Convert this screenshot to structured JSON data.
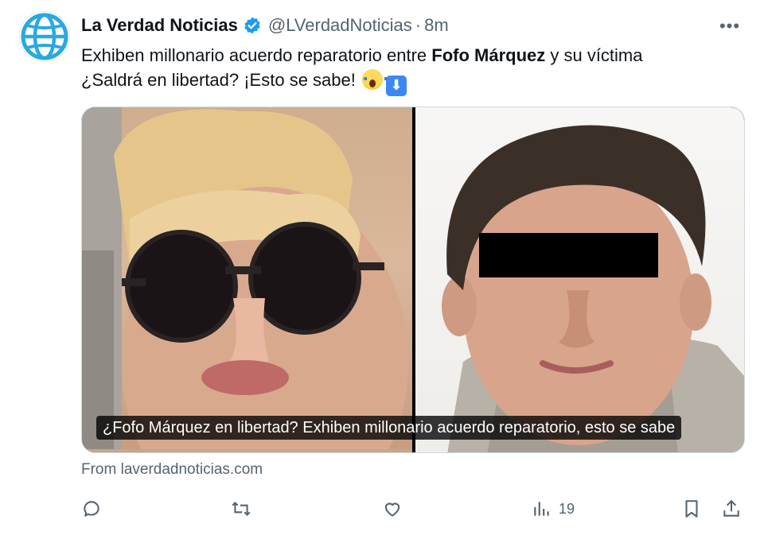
{
  "author": {
    "display_name": "La Verdad Noticias",
    "handle": "@LVerdadNoticias",
    "separator": "·",
    "time": "8m",
    "avatar_icon": "globe-icon",
    "verified_color": "#1d9bf0"
  },
  "menu": {
    "more_icon": "more-icon",
    "label": "•••"
  },
  "tweet": {
    "text_before": "Exhiben millonario acuerdo reparatorio entre ",
    "text_bold": "Fofo Márquez",
    "text_after": " y su víctima",
    "line2": "¿Saldrá en libertad? ¡Esto se sabe! ",
    "emoji_1": "face-screaming-emoji",
    "emoji_2": "down-arrow-emoji",
    "emoji_2_glyph": "⬇"
  },
  "card": {
    "caption": "¿Fofo Márquez en libertad? Exhiben millonario acuerdo reparatorio, esto se sabe",
    "source": "From laverdadnoticias.com"
  },
  "actions": {
    "reply_icon": "reply-icon",
    "retweet_icon": "retweet-icon",
    "like_icon": "like-icon",
    "views_icon": "views-icon",
    "views_count": "19",
    "bookmark_icon": "bookmark-icon",
    "share_icon": "share-icon"
  },
  "colors": {
    "text": "#0f1419",
    "muted": "#536471",
    "accent": "#1d9bf0",
    "border": "#cfd9de"
  }
}
